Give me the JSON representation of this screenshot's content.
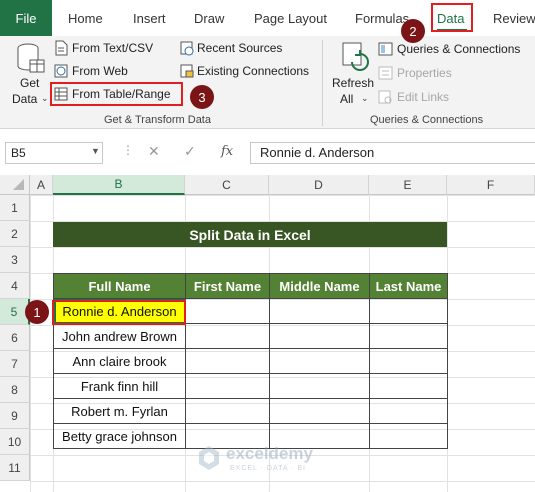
{
  "ribbon_tabs": {
    "file": "File",
    "home": "Home",
    "insert": "Insert",
    "draw": "Draw",
    "page_layout": "Page Layout",
    "formulas": "Formulas",
    "data": "Data",
    "review": "Review"
  },
  "get_transform": {
    "get_data_line1": "Get",
    "get_data_line2": "Data",
    "from_text_csv": "From Text/CSV",
    "from_web": "From Web",
    "from_table_range": "From Table/Range",
    "recent_sources": "Recent Sources",
    "existing_connections": "Existing Connections",
    "group_label": "Get & Transform Data"
  },
  "queries_connections": {
    "refresh_line1": "Refresh",
    "refresh_line2": "All",
    "queries_connections": "Queries & Connections",
    "properties": "Properties",
    "edit_links": "Edit Links",
    "group_label": "Queries & Connections"
  },
  "formula_bar": {
    "name_box": "B5",
    "fx_label": "fx",
    "content": "Ronnie d. Anderson"
  },
  "columns": [
    "A",
    "B",
    "C",
    "D",
    "E",
    "F"
  ],
  "rows": [
    "1",
    "2",
    "3",
    "4",
    "5",
    "6",
    "7",
    "8",
    "9",
    "10",
    "11"
  ],
  "sheet": {
    "title": "Split Data in Excel",
    "headers": [
      "Full Name",
      "First Name",
      "Middle Name",
      "Last Name"
    ],
    "names": [
      "Ronnie d. Anderson",
      "John andrew Brown",
      "Ann claire brook",
      "Frank finn hill",
      "Robert m. Fyrlan",
      "Betty grace johnson"
    ]
  },
  "callouts": [
    "1",
    "2",
    "3"
  ],
  "watermark": {
    "brand": "exceldemy",
    "tagline": "EXCEL · DATA · BI"
  },
  "colors": {
    "excel_green": "#217346",
    "title_fill": "#375623",
    "header_fill": "#548235",
    "highlight": "#ffff00",
    "callout_red": "#e02020",
    "badge": "#7b1416"
  }
}
